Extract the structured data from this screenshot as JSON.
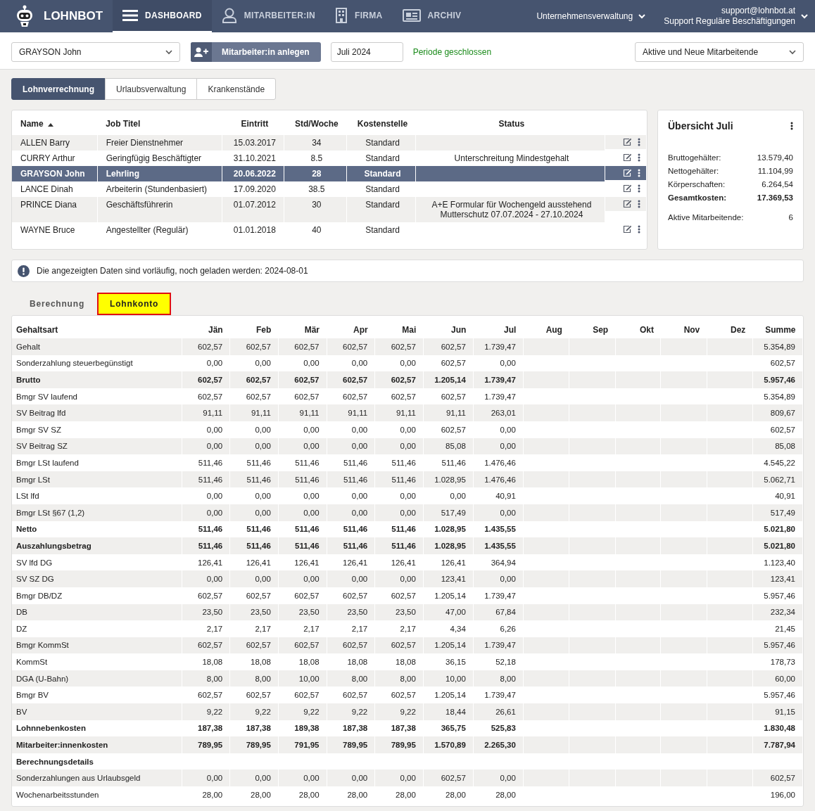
{
  "brand": "LOHNBOT",
  "nav": [
    {
      "label": "DASHBOARD",
      "selected": true
    },
    {
      "label": "MITARBEITER:IN",
      "selected": false
    },
    {
      "label": "FIRMA",
      "selected": false
    },
    {
      "label": "ARCHIV",
      "selected": false
    }
  ],
  "company_menu": "Unternehmensverwaltung",
  "user": {
    "email": "support@lohnbot.at",
    "role": "Support Reguläre Beschäftigungen"
  },
  "toolbar": {
    "employee": "GRAYSON John",
    "add_button": "Mitarbeiter:in anlegen",
    "period": "Juli 2024",
    "period_status": "Periode geschlossen",
    "filter": "Aktive und Neue Mitarbeitende"
  },
  "tabs": [
    {
      "label": "Lohnverrechnung",
      "selected": true
    },
    {
      "label": "Urlaubsverwaltung",
      "selected": false
    },
    {
      "label": "Krankenstände",
      "selected": false
    }
  ],
  "employees": {
    "columns": [
      "Name",
      "Job Titel",
      "Eintritt",
      "Std/Woche",
      "Kostenstelle",
      "Status"
    ],
    "rows": [
      {
        "name": "ALLEN Barry",
        "job": "Freier Dienstnehmer",
        "start": "15.03.2017",
        "hours": "34",
        "cost_center": "Standard",
        "status": [],
        "selected": false
      },
      {
        "name": "CURRY Arthur",
        "job": "Geringfügig Beschäftigter",
        "start": "31.10.2021",
        "hours": "8.5",
        "cost_center": "Standard",
        "status": [
          "Unterschreitung Mindestgehalt"
        ],
        "selected": false
      },
      {
        "name": "GRAYSON John",
        "job": "Lehrling",
        "start": "20.06.2022",
        "hours": "28",
        "cost_center": "Standard",
        "status": [],
        "selected": true
      },
      {
        "name": "LANCE Dinah",
        "job": "Arbeiterin (Stundenbasiert)",
        "start": "17.09.2020",
        "hours": "38.5",
        "cost_center": "Standard",
        "status": [],
        "selected": false
      },
      {
        "name": "PRINCE Diana",
        "job": "Geschäftsführerin",
        "start": "01.07.2012",
        "hours": "30",
        "cost_center": "Standard",
        "status": [
          "A+E Formular für Wochengeld ausstehend",
          "Mutterschutz 07.07.2024 - 27.10.2024"
        ],
        "selected": false
      },
      {
        "name": "WAYNE Bruce",
        "job": "Angestellter (Regulär)",
        "start": "01.01.2018",
        "hours": "40",
        "cost_center": "Standard",
        "status": [],
        "selected": false
      }
    ]
  },
  "overview": {
    "title": "Übersicht Juli",
    "items": [
      {
        "label": "Bruttogehälter:",
        "value": "13.579,40",
        "bold": false
      },
      {
        "label": "Nettogehälter:",
        "value": "11.104,99",
        "bold": false
      },
      {
        "label": "Körperschaften:",
        "value": "6.264,54",
        "bold": false
      },
      {
        "label": "Gesamtkosten:",
        "value": "17.369,53",
        "bold": true
      }
    ],
    "active_label": "Aktive Mitarbeitende:",
    "active_value": "6"
  },
  "notice": "Die angezeigten Daten sind vorläufig, noch geladen werden: 2024-08-01",
  "view_tabs": [
    {
      "label": "Berechnung",
      "selected": false
    },
    {
      "label": "Lohnkonto",
      "selected": true
    }
  ],
  "ledger": {
    "columns": [
      "Gehaltsart",
      "Jän",
      "Feb",
      "Mär",
      "Apr",
      "Mai",
      "Jun",
      "Jul",
      "Aug",
      "Sep",
      "Okt",
      "Nov",
      "Dez",
      "Summe"
    ],
    "rows": [
      {
        "label": "Gehalt",
        "bold": false,
        "values": [
          "602,57",
          "602,57",
          "602,57",
          "602,57",
          "602,57",
          "602,57",
          "1.739,47"
        ],
        "sum": "5.354,89"
      },
      {
        "label": "Sonderzahlung steuerbegünstigt",
        "bold": false,
        "values": [
          "0,00",
          "0,00",
          "0,00",
          "0,00",
          "0,00",
          "602,57",
          "0,00"
        ],
        "sum": "602,57"
      },
      {
        "label": "Brutto",
        "bold": true,
        "values": [
          "602,57",
          "602,57",
          "602,57",
          "602,57",
          "602,57",
          "1.205,14",
          "1.739,47"
        ],
        "sum": "5.957,46"
      },
      {
        "label": "Bmgr SV laufend",
        "bold": false,
        "values": [
          "602,57",
          "602,57",
          "602,57",
          "602,57",
          "602,57",
          "602,57",
          "1.739,47"
        ],
        "sum": "5.354,89"
      },
      {
        "label": "SV Beitrag lfd",
        "bold": false,
        "values": [
          "91,11",
          "91,11",
          "91,11",
          "91,11",
          "91,11",
          "91,11",
          "263,01"
        ],
        "sum": "809,67"
      },
      {
        "label": "Bmgr SV SZ",
        "bold": false,
        "values": [
          "0,00",
          "0,00",
          "0,00",
          "0,00",
          "0,00",
          "602,57",
          "0,00"
        ],
        "sum": "602,57"
      },
      {
        "label": "SV Beitrag SZ",
        "bold": false,
        "values": [
          "0,00",
          "0,00",
          "0,00",
          "0,00",
          "0,00",
          "85,08",
          "0,00"
        ],
        "sum": "85,08"
      },
      {
        "label": "Bmgr LSt laufend",
        "bold": false,
        "values": [
          "511,46",
          "511,46",
          "511,46",
          "511,46",
          "511,46",
          "511,46",
          "1.476,46"
        ],
        "sum": "4.545,22"
      },
      {
        "label": "Bmgr LSt",
        "bold": false,
        "values": [
          "511,46",
          "511,46",
          "511,46",
          "511,46",
          "511,46",
          "1.028,95",
          "1.476,46"
        ],
        "sum": "5.062,71"
      },
      {
        "label": "LSt lfd",
        "bold": false,
        "values": [
          "0,00",
          "0,00",
          "0,00",
          "0,00",
          "0,00",
          "0,00",
          "40,91"
        ],
        "sum": "40,91"
      },
      {
        "label": "Bmgr LSt §67 (1,2)",
        "bold": false,
        "values": [
          "0,00",
          "0,00",
          "0,00",
          "0,00",
          "0,00",
          "517,49",
          "0,00"
        ],
        "sum": "517,49"
      },
      {
        "label": "Netto",
        "bold": true,
        "values": [
          "511,46",
          "511,46",
          "511,46",
          "511,46",
          "511,46",
          "1.028,95",
          "1.435,55"
        ],
        "sum": "5.021,80"
      },
      {
        "label": "Auszahlungsbetrag",
        "bold": true,
        "values": [
          "511,46",
          "511,46",
          "511,46",
          "511,46",
          "511,46",
          "1.028,95",
          "1.435,55"
        ],
        "sum": "5.021,80"
      },
      {
        "label": "SV lfd DG",
        "bold": false,
        "values": [
          "126,41",
          "126,41",
          "126,41",
          "126,41",
          "126,41",
          "126,41",
          "364,94"
        ],
        "sum": "1.123,40"
      },
      {
        "label": "SV SZ DG",
        "bold": false,
        "values": [
          "0,00",
          "0,00",
          "0,00",
          "0,00",
          "0,00",
          "123,41",
          "0,00"
        ],
        "sum": "123,41"
      },
      {
        "label": "Bmgr DB/DZ",
        "bold": false,
        "values": [
          "602,57",
          "602,57",
          "602,57",
          "602,57",
          "602,57",
          "1.205,14",
          "1.739,47"
        ],
        "sum": "5.957,46"
      },
      {
        "label": "DB",
        "bold": false,
        "values": [
          "23,50",
          "23,50",
          "23,50",
          "23,50",
          "23,50",
          "47,00",
          "67,84"
        ],
        "sum": "232,34"
      },
      {
        "label": "DZ",
        "bold": false,
        "values": [
          "2,17",
          "2,17",
          "2,17",
          "2,17",
          "2,17",
          "4,34",
          "6,26"
        ],
        "sum": "21,45"
      },
      {
        "label": "Bmgr KommSt",
        "bold": false,
        "values": [
          "602,57",
          "602,57",
          "602,57",
          "602,57",
          "602,57",
          "1.205,14",
          "1.739,47"
        ],
        "sum": "5.957,46"
      },
      {
        "label": "KommSt",
        "bold": false,
        "values": [
          "18,08",
          "18,08",
          "18,08",
          "18,08",
          "18,08",
          "36,15",
          "52,18"
        ],
        "sum": "178,73"
      },
      {
        "label": "DGA (U-Bahn)",
        "bold": false,
        "values": [
          "8,00",
          "8,00",
          "10,00",
          "8,00",
          "8,00",
          "10,00",
          "8,00"
        ],
        "sum": "60,00"
      },
      {
        "label": "Bmgr BV",
        "bold": false,
        "values": [
          "602,57",
          "602,57",
          "602,57",
          "602,57",
          "602,57",
          "1.205,14",
          "1.739,47"
        ],
        "sum": "5.957,46"
      },
      {
        "label": "BV",
        "bold": false,
        "values": [
          "9,22",
          "9,22",
          "9,22",
          "9,22",
          "9,22",
          "18,44",
          "26,61"
        ],
        "sum": "91,15"
      },
      {
        "label": "Lohnnebenkosten",
        "bold": true,
        "values": [
          "187,38",
          "187,38",
          "189,38",
          "187,38",
          "187,38",
          "365,75",
          "525,83"
        ],
        "sum": "1.830,48"
      },
      {
        "label": "Mitarbeiter:innenkosten",
        "bold": true,
        "values": [
          "789,95",
          "789,95",
          "791,95",
          "789,95",
          "789,95",
          "1.570,89",
          "2.265,30"
        ],
        "sum": "7.787,94"
      },
      {
        "label": "Berechnungsdetails",
        "bold": true,
        "values": []
      },
      {
        "label": "Sonderzahlungen aus Urlaubsgeld",
        "bold": false,
        "values": [
          "0,00",
          "0,00",
          "0,00",
          "0,00",
          "0,00",
          "602,57",
          "0,00"
        ],
        "sum": "602,57"
      },
      {
        "label": "Wochenarbeitsstunden",
        "bold": false,
        "values": [
          "28,00",
          "28,00",
          "28,00",
          "28,00",
          "28,00",
          "28,00",
          "28,00"
        ],
        "sum": "196,00"
      }
    ]
  }
}
